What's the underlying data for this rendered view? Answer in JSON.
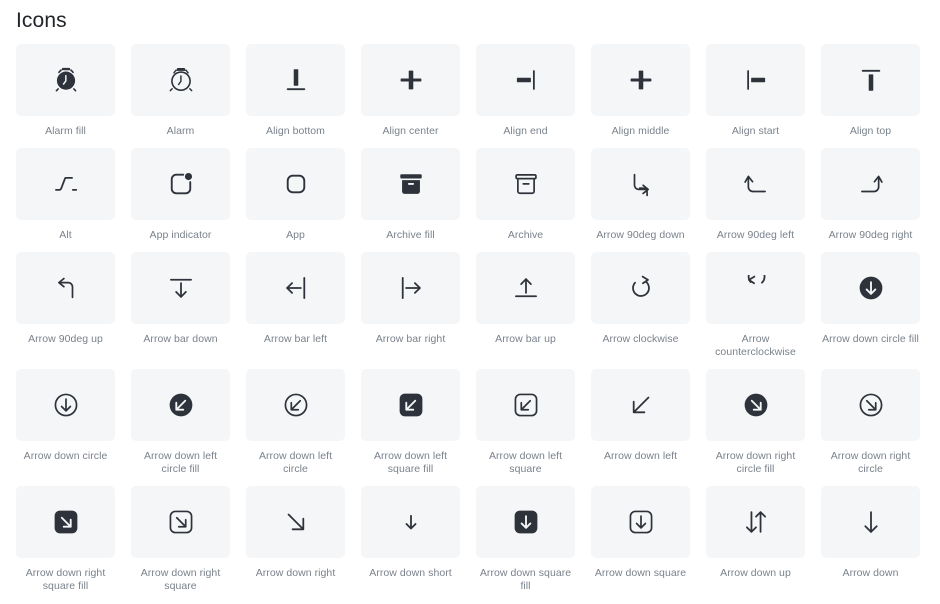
{
  "page": {
    "title": "Icons",
    "background_color": "#ffffff",
    "tile_background_color": "#f5f6f8",
    "icon_color": "#2e333b",
    "label_color": "#7a828b",
    "columns": 8
  },
  "icons": [
    {
      "label": "Alarm fill",
      "name": "alarm-fill-icon"
    },
    {
      "label": "Alarm",
      "name": "alarm-icon"
    },
    {
      "label": "Align bottom",
      "name": "align-bottom-icon"
    },
    {
      "label": "Align center",
      "name": "align-center-icon"
    },
    {
      "label": "Align end",
      "name": "align-end-icon"
    },
    {
      "label": "Align middle",
      "name": "align-middle-icon"
    },
    {
      "label": "Align start",
      "name": "align-start-icon"
    },
    {
      "label": "Align top",
      "name": "align-top-icon"
    },
    {
      "label": "Alt",
      "name": "alt-icon"
    },
    {
      "label": "App indicator",
      "name": "app-indicator-icon"
    },
    {
      "label": "App",
      "name": "app-icon"
    },
    {
      "label": "Archive fill",
      "name": "archive-fill-icon"
    },
    {
      "label": "Archive",
      "name": "archive-icon"
    },
    {
      "label": "Arrow 90deg down",
      "name": "arrow-90deg-down-icon"
    },
    {
      "label": "Arrow 90deg left",
      "name": "arrow-90deg-left-icon"
    },
    {
      "label": "Arrow 90deg right",
      "name": "arrow-90deg-right-icon"
    },
    {
      "label": "Arrow 90deg up",
      "name": "arrow-90deg-up-icon"
    },
    {
      "label": "Arrow bar down",
      "name": "arrow-bar-down-icon"
    },
    {
      "label": "Arrow bar left",
      "name": "arrow-bar-left-icon"
    },
    {
      "label": "Arrow bar right",
      "name": "arrow-bar-right-icon"
    },
    {
      "label": "Arrow bar up",
      "name": "arrow-bar-up-icon"
    },
    {
      "label": "Arrow clockwise",
      "name": "arrow-clockwise-icon"
    },
    {
      "label": "Arrow counterclockwise",
      "name": "arrow-counterclockwise-icon"
    },
    {
      "label": "Arrow down circle fill",
      "name": "arrow-down-circle-fill-icon"
    },
    {
      "label": "Arrow down circle",
      "name": "arrow-down-circle-icon"
    },
    {
      "label": "Arrow down left circle fill",
      "name": "arrow-down-left-circle-fill-icon"
    },
    {
      "label": "Arrow down left circle",
      "name": "arrow-down-left-circle-icon"
    },
    {
      "label": "Arrow down left square fill",
      "name": "arrow-down-left-square-fill-icon"
    },
    {
      "label": "Arrow down left square",
      "name": "arrow-down-left-square-icon"
    },
    {
      "label": "Arrow down left",
      "name": "arrow-down-left-icon"
    },
    {
      "label": "Arrow down right circle fill",
      "name": "arrow-down-right-circle-fill-icon"
    },
    {
      "label": "Arrow down right circle",
      "name": "arrow-down-right-circle-icon"
    },
    {
      "label": "Arrow down right square fill",
      "name": "arrow-down-right-square-fill-icon"
    },
    {
      "label": "Arrow down right square",
      "name": "arrow-down-right-square-icon"
    },
    {
      "label": "Arrow down right",
      "name": "arrow-down-right-icon"
    },
    {
      "label": "Arrow down short",
      "name": "arrow-down-short-icon"
    },
    {
      "label": "Arrow down square fill",
      "name": "arrow-down-square-fill-icon"
    },
    {
      "label": "Arrow down square",
      "name": "arrow-down-square-icon"
    },
    {
      "label": "Arrow down up",
      "name": "arrow-down-up-icon"
    },
    {
      "label": "Arrow down",
      "name": "arrow-down-icon"
    }
  ]
}
